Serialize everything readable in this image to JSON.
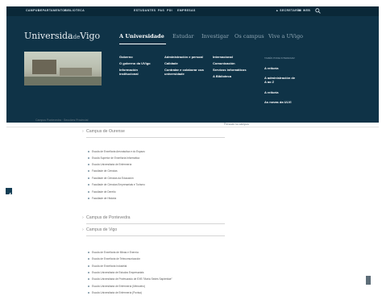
{
  "topbar": {
    "left_links": [
      "CAMPUS",
      "DEPARTAMENTOS",
      "BIBLIOTECA"
    ],
    "lang_links": [
      "ESTUDANTES",
      "PAS",
      "PDI",
      "EMPRESAS"
    ],
    "right_links": [
      "SECRETARÍA",
      "MI WEB"
    ]
  },
  "logo": {
    "part1": "Universida",
    "de": "de",
    "part2": "Vigo"
  },
  "nav": {
    "items": [
      "A Universidade",
      "Estudar",
      "Investigar",
      "Os campus",
      "Vive a UVigo"
    ],
    "active_index": 0
  },
  "menu": {
    "col1": [
      "Goberno",
      "O goberno da UVigo",
      "Información institucional"
    ],
    "col2": [
      "Administración e persoal",
      "Calidade",
      "Contratar e colaborar coa universidade"
    ],
    "col3": [
      "Internacional",
      "Comunicación",
      "Servizos informáticos",
      "A Biblioteca"
    ]
  },
  "right_column": {
    "heading": "TAMÉN PODE INTERESAR",
    "items": [
      "A reitoría",
      "A administración de A ao Z",
      "A reitoría",
      "As novas da ULVI"
    ]
  },
  "breadcrumb": "Campus Pontevedra · Seccións Provincial",
  "breadcrumb_right": "Persoas no campus",
  "sections": [
    "Campus de Ourense",
    "Campus de Pontevedra",
    "Campus de Vigo"
  ],
  "ourense_schools": [
    "Escola de Enxeñaría Aeronáutica e do Espazo",
    "Escola Superior de Enxeñaría Informática",
    "Escola Universitaria de Enfermería",
    "Facultade de Ciencias",
    "Facultade de Ciencias da Educación",
    "Facultade de Ciencias Empresariais e Turismo",
    "Facultade de Dereito",
    "Facultade de Historia"
  ],
  "vigo_schools": [
    "Escola de Enxeñaría de Minas e Enerxía",
    "Escola de Enxeñaría de Telecomunicación",
    "Escola de Enxeñaría Industrial",
    "Escola Universitaria de Estudos Empresariais",
    "Escola Universitaria de Profesorado de EXB \"María Sedes Sapientiae\"",
    "Escola Universitaria de Enfermería (Meixoeiro)",
    "Escola Universitaria de Enfermería (Povisa)"
  ]
}
